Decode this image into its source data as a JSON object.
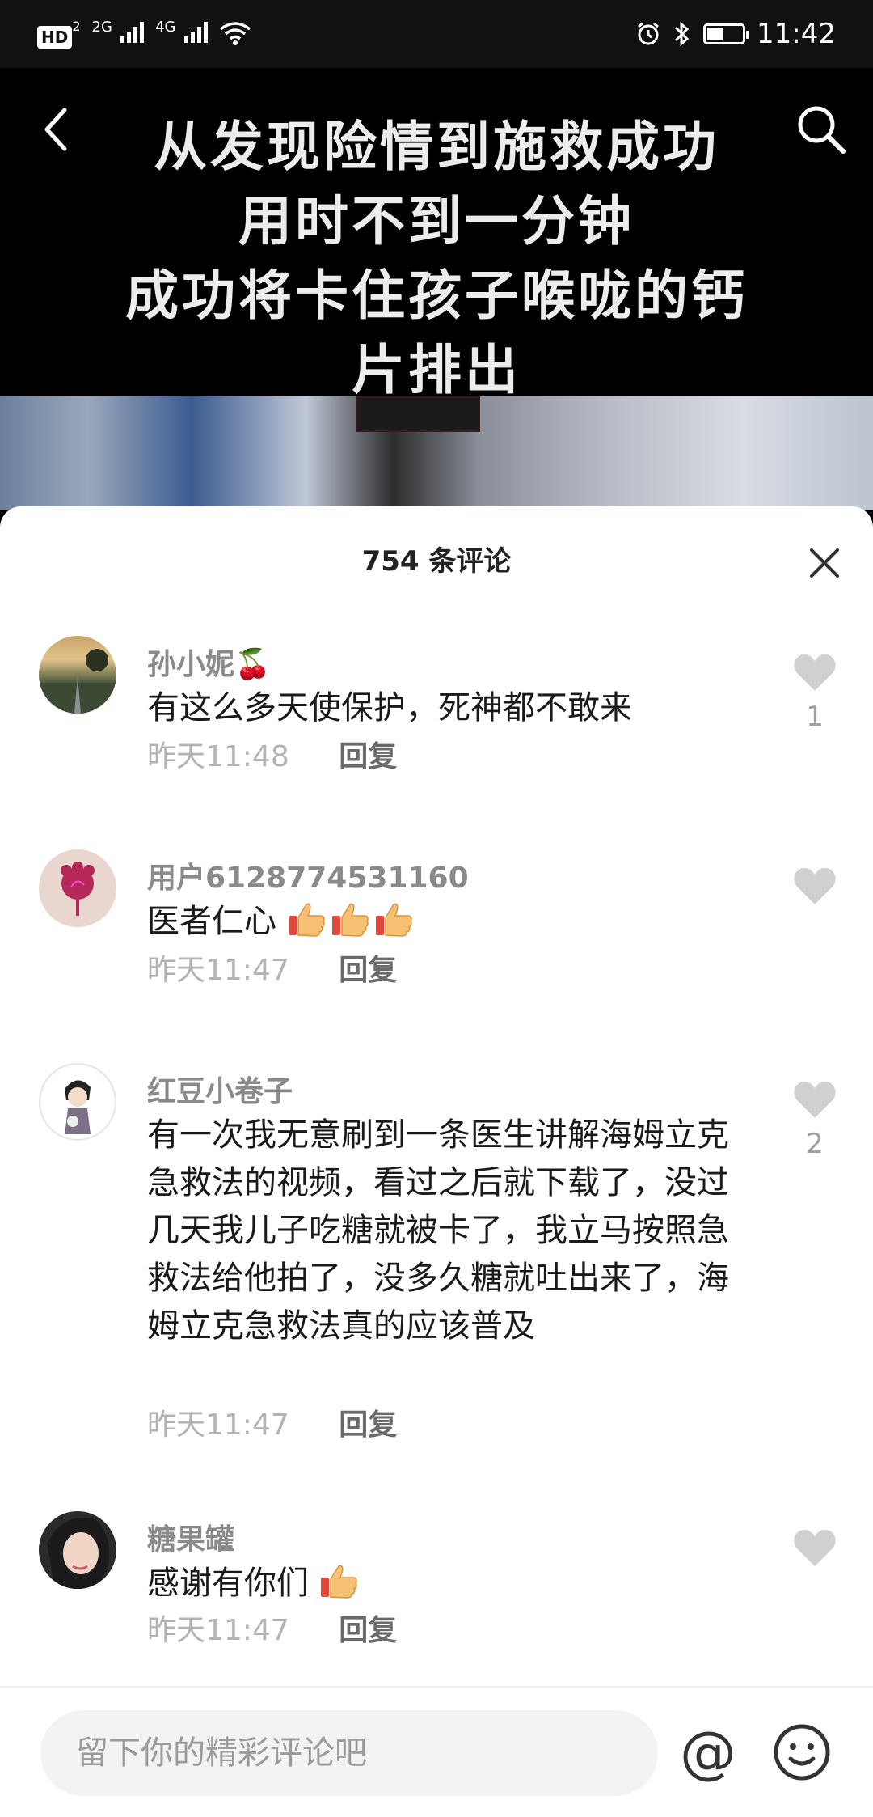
{
  "status_bar": {
    "hd_badge": "HD",
    "hd_sub": "2",
    "net1": "2G",
    "net2": "4G",
    "time": "11:42",
    "battery_level": 0.45
  },
  "video": {
    "caption_lines": [
      "从发现险情到施救成功",
      "用时不到一分钟",
      "成功将卡住孩子喉咙的钙",
      "片排出"
    ],
    "back_icon": "chevron-left-icon",
    "search_icon": "search-icon"
  },
  "comments_sheet": {
    "title": "754 条评论",
    "close_icon": "close-icon",
    "reply_label": "回复",
    "comments": [
      {
        "user": "孙小妮🍒",
        "text": "有这么多天使保护，死神都不敢来",
        "time": "昨天11:48",
        "likes": "1"
      },
      {
        "user": "用户6128774531160",
        "text": "医者仁心",
        "emoji_count": 3,
        "time": "昨天11:47",
        "likes": ""
      },
      {
        "user": "红豆小卷子",
        "text": "有一次我无意刷到一条医生讲解海姆立克急救法的视频，看过之后就下载了，没过几天我儿子吃糖就被卡了，我立马按照急救法给他拍了，没多久糖就吐出来了，海姆立克急救法真的应该普及",
        "time": "昨天11:47",
        "likes": "2"
      },
      {
        "user": "糖果罐",
        "text": "感谢有你们",
        "emoji_count": 1,
        "time": "昨天11:47",
        "likes": ""
      }
    ]
  },
  "bottom_bar": {
    "placeholder": "留下你的精彩评论吧",
    "at_label": "@",
    "emoji_icon": "smiley-icon"
  },
  "colors": {
    "accent_like": "#cfcfcf",
    "username": "#8a8a8a",
    "meta": "#b3b3b3"
  }
}
